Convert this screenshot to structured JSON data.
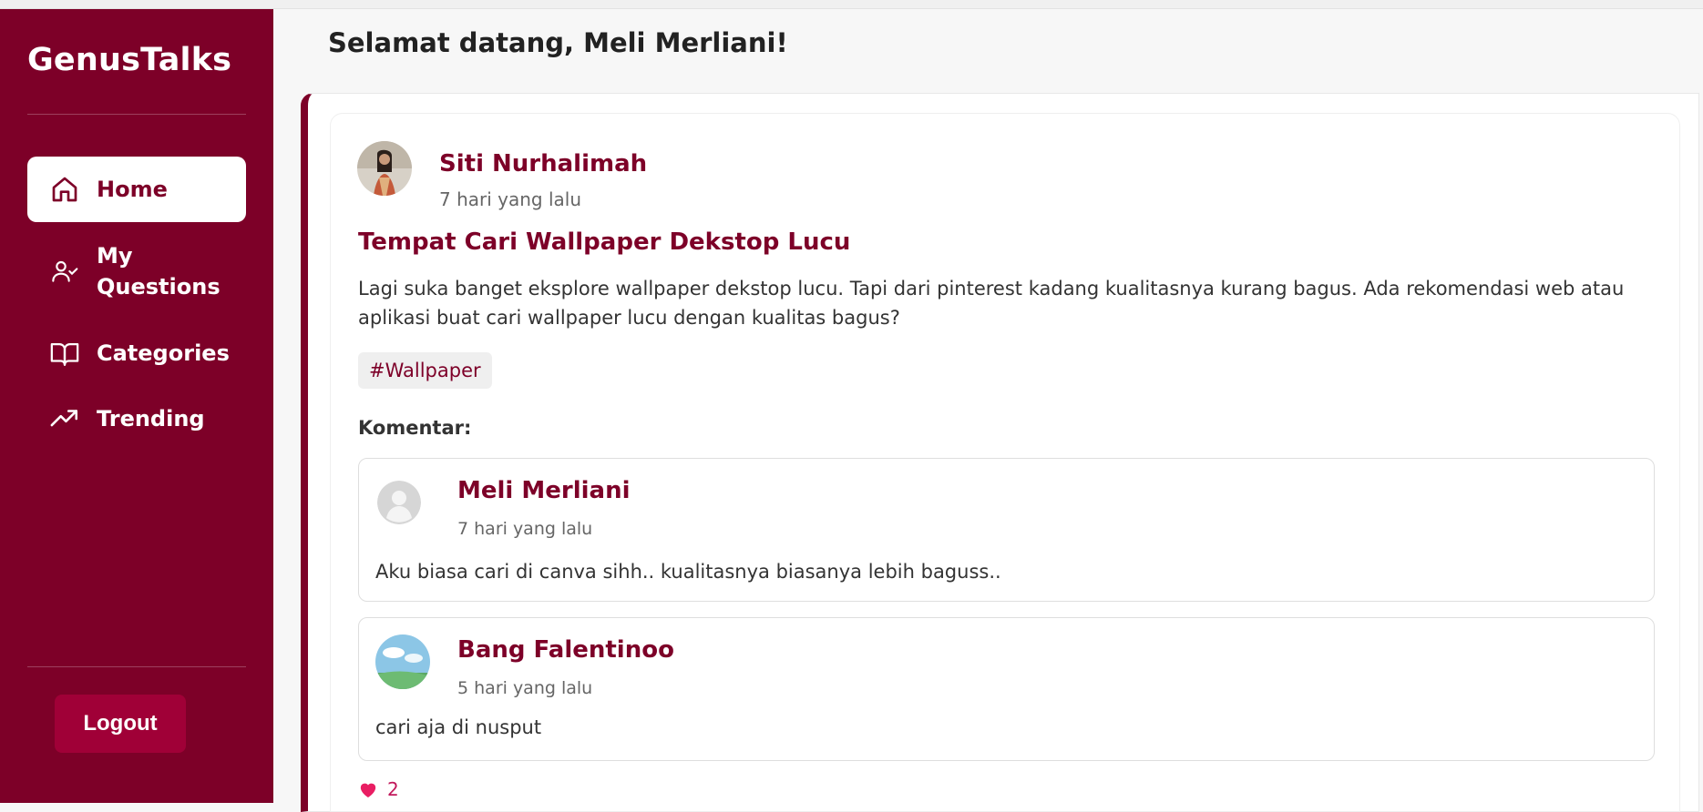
{
  "app": {
    "brand": "GenusTalks"
  },
  "sidebar": {
    "items": [
      {
        "label": "Home",
        "icon": "home-icon",
        "active": true
      },
      {
        "label": "My Questions",
        "icon": "user-check-icon",
        "active": false
      },
      {
        "label": "Categories",
        "icon": "book-open-icon",
        "active": false
      },
      {
        "label": "Trending",
        "icon": "trending-up-icon",
        "active": false
      }
    ],
    "logout_label": "Logout"
  },
  "header": {
    "welcome": "Selamat datang, Meli Merliani!"
  },
  "post": {
    "author": "Siti Nurhalimah",
    "time": "7 hari yang lalu",
    "title": "Tempat Cari Wallpaper Dekstop Lucu",
    "body": "Lagi suka banget eksplore wallpaper dekstop lucu. Tapi dari pinterest kadang kualitasnya kurang bagus. Ada rekomendasi web atau aplikasi buat cari wallpaper lucu dengan kualitas bagus?",
    "tag": "#Wallpaper",
    "comments_title": "Komentar:",
    "comments": [
      {
        "author": "Meli Merliani",
        "time": "7 hari yang lalu",
        "text": "Aku biasa cari di canva sihh.. kualitasnya biasanya lebih baguss.."
      },
      {
        "author": "Bang Falentinoo",
        "time": "5 hari yang lalu",
        "text": "cari aja di nusput"
      }
    ],
    "likes": "2"
  },
  "colors": {
    "brand": "#7d0028",
    "logout": "#a00037",
    "like": "#e91e63"
  }
}
